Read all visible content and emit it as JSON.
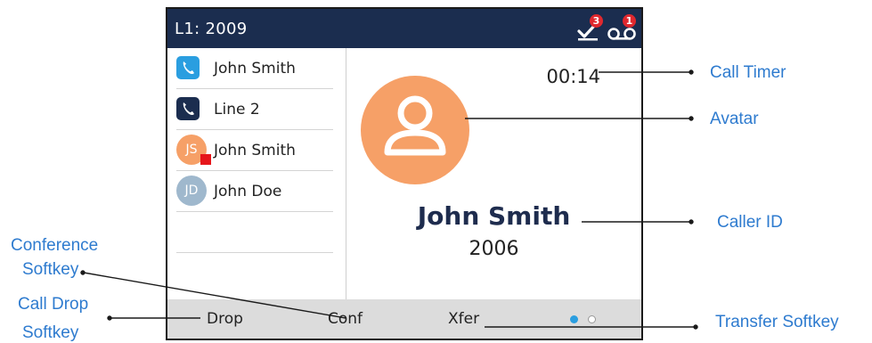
{
  "status_bar": {
    "line_label": "L1: 2009",
    "missed_calls_icon": "missed-call-check-icon",
    "missed_calls_count": "3",
    "voicemail_icon": "voicemail-icon",
    "voicemail_count": "1"
  },
  "calls": [
    {
      "type": "phone",
      "name": "John Smith",
      "icon_color": "#2a9ee0"
    },
    {
      "type": "phone",
      "name": "Line 2",
      "icon_color": "#1b2d4f"
    },
    {
      "type": "contact",
      "initials": "JS",
      "name": "John Smith",
      "avatar_color": "#f6a067",
      "presence_color": "#e6161b"
    },
    {
      "type": "contact",
      "initials": "JD",
      "name": "John Doe",
      "avatar_color": "#9fb8cd"
    }
  ],
  "active_call": {
    "timer": "00:14",
    "avatar_color": "#f6a067",
    "caller_name": "John Smith",
    "caller_number": "2006"
  },
  "softkeys": [
    "Drop",
    "Conf",
    "Xfer"
  ],
  "page_dots": {
    "active_color": "#2a9ee0",
    "count": 2,
    "active": 1
  },
  "callouts": {
    "call_timer": "Call Timer",
    "avatar": "Avatar",
    "caller_id": "Caller ID",
    "conference_softkey": [
      "Conference",
      "Softkey"
    ],
    "call_drop_softkey": [
      "Call Drop",
      "Softkey"
    ],
    "transfer_softkey": "Transfer Softkey"
  },
  "colors": {
    "title_bar": "#1b2d4f",
    "softkey_bar": "#dcdcdc",
    "callout_text": "#2e7bcf",
    "badge": "#e0282e"
  }
}
